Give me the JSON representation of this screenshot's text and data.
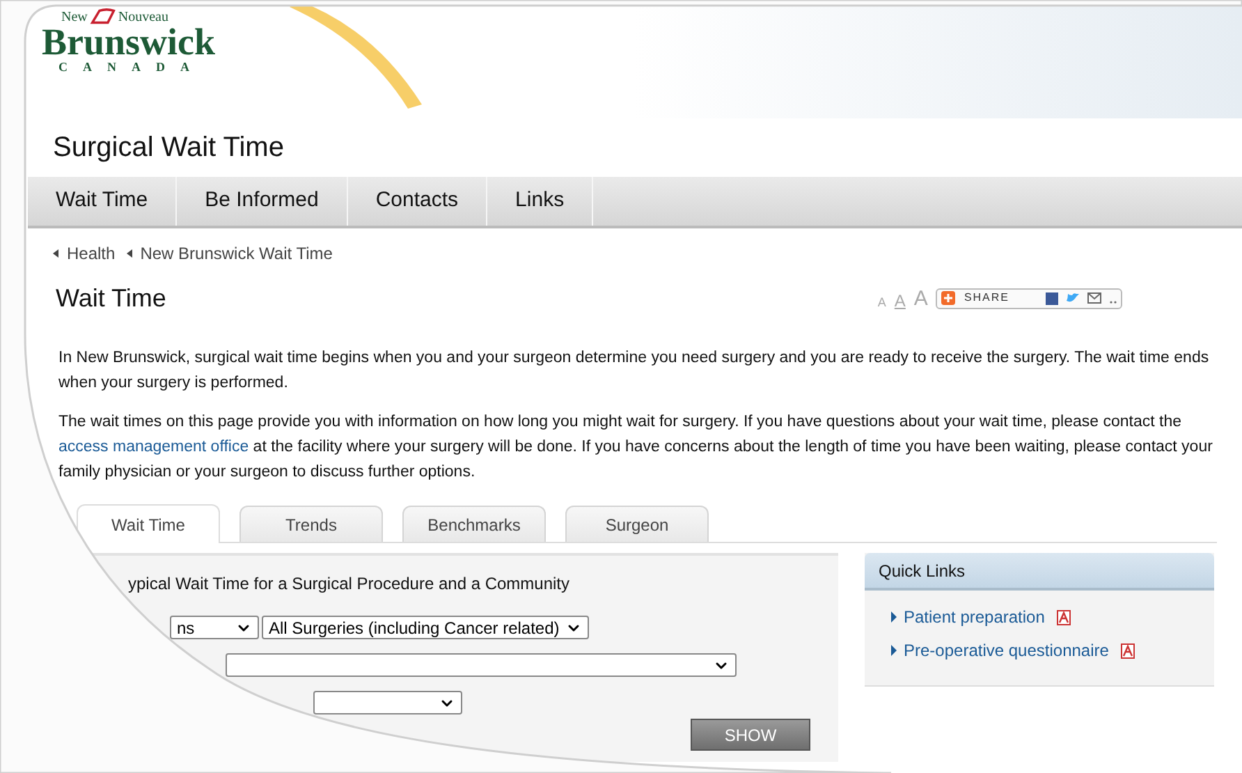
{
  "logo": {
    "word_left": "New",
    "word_right": "Nouveau",
    "name": "Brunswick",
    "country": "CANADA"
  },
  "site_title": "Surgical Wait Time",
  "nav": [
    "Wait Time",
    "Be Informed",
    "Contacts",
    "Links"
  ],
  "breadcrumb": [
    "Health",
    "New Brunswick Wait Time"
  ],
  "page_title": "Wait Time",
  "font_size_buttons": [
    "A",
    "A",
    "A"
  ],
  "share": {
    "label": "SHARE"
  },
  "paragraphs": [
    {
      "parts": [
        {
          "text": "In New Brunswick, surgical wait time begins when you and your surgeon determine you need surgery and you are ready to receive the surgery. The wait time ends when your surgery is performed.",
          "kind": "plain"
        }
      ]
    },
    {
      "parts": [
        {
          "text": "The wait times on this page provide you with information on how long you might wait for surgery. If you have questions about your wait time, please contact the",
          "kind": "plain"
        },
        {
          "text": "access management office",
          "kind": "link"
        },
        {
          "text": "at the facility where your surgery will be done. If you have concerns about the length of time you have been waiting, please contact your family physician or your surgeon to discuss further options.",
          "kind": "plain"
        }
      ]
    }
  ],
  "tabs": [
    {
      "label": "Wait Time",
      "selected": true
    },
    {
      "label": "Trends",
      "selected": false
    },
    {
      "label": "Benchmarks",
      "selected": false
    },
    {
      "label": "Surgeon",
      "selected": false
    }
  ],
  "form": {
    "caption": "ypical Wait Time for a Surgical Procedure and a Community",
    "select_1": "ns",
    "select_2": "All Surgeries (including Cancer related)",
    "button": "SHOW"
  },
  "quick_links": {
    "title": "Quick Links",
    "items": [
      "Patient preparation",
      "Pre-operative questionnaire"
    ]
  }
}
